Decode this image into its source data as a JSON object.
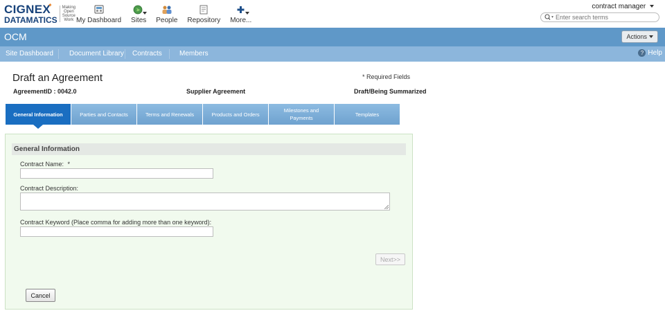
{
  "logo": {
    "name_line1": "CIGNEX",
    "name_line2": "DATAMATICS",
    "tagline": [
      "Making",
      "Open",
      "Source",
      "Work"
    ]
  },
  "top_nav": {
    "items": [
      {
        "label": "My Dashboard",
        "icon": "dashboard-icon"
      },
      {
        "label": "Sites",
        "icon": "globe-icon",
        "has_menu": true
      },
      {
        "label": "People",
        "icon": "people-icon"
      },
      {
        "label": "Repository",
        "icon": "repository-icon"
      },
      {
        "label": "More...",
        "icon": "plus-icon",
        "has_menu": true
      }
    ]
  },
  "user_menu": {
    "label": "contract manager"
  },
  "search": {
    "placeholder": "Enter search terms"
  },
  "site": {
    "title": "OCM"
  },
  "actions": {
    "label": "Actions"
  },
  "sub_nav": {
    "items": [
      "Site Dashboard",
      "Document Library",
      "Contracts",
      "Members"
    ],
    "help": "Help"
  },
  "page": {
    "title": "Draft an Agreement",
    "required_note": "* Required Fields",
    "agreement_id": "AgreementID : 0042.0",
    "agreement_type": "Supplier Agreement",
    "status": "Draft/Being Summarized"
  },
  "tabs": [
    "General Information",
    "Parties and Contacts",
    "Terms and Renewals",
    "Products and Orders",
    "Milestones and Payments",
    "Templates"
  ],
  "form": {
    "section_title": "General Information",
    "contract_name_label": "Contract Name:",
    "required_marker": "*",
    "contract_name_value": "",
    "contract_description_label": "Contract Description:",
    "contract_description_value": "",
    "contract_keyword_label": "Contract Keyword (Place comma for adding more than one keyword):",
    "contract_keyword_value": "",
    "next_label": "Next>>",
    "cancel_label": "Cancel"
  },
  "colors": {
    "header_bar": "#5f98c8",
    "sub_nav": "#8cb6dc",
    "active_tab": "#1a6ec1",
    "form_panel": "#f1faee"
  }
}
